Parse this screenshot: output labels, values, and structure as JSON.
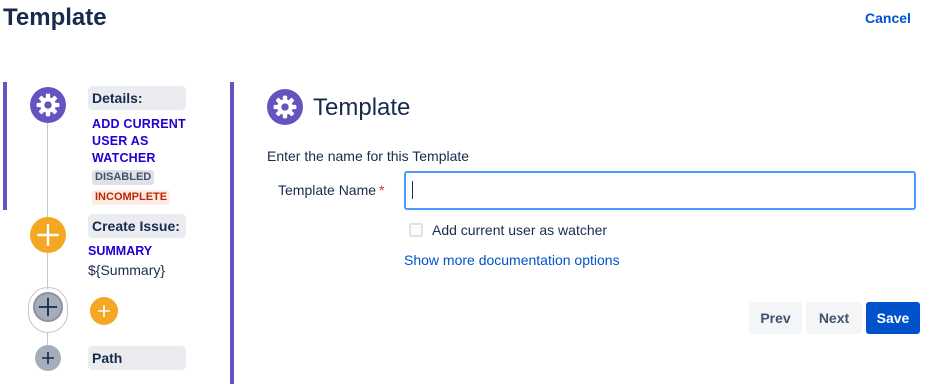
{
  "header": {
    "title": "Template",
    "cancel_label": "Cancel"
  },
  "steps": {
    "details": {
      "label": "Details:",
      "action": "ADD CURRENT USER AS WATCHER",
      "badges": [
        "DISABLED",
        "INCOMPLETE"
      ]
    },
    "create_issue": {
      "label": "Create Issue:",
      "field_key": "SUMMARY",
      "field_value": "${Summary}"
    },
    "path": {
      "label": "Path"
    }
  },
  "form": {
    "title": "Template",
    "instructions": "Enter the name for this Template",
    "name_label": "Template Name",
    "required_marker": "*",
    "name_value": "",
    "watcher_label": "Add current user as watcher",
    "watcher_checked": false,
    "doc_link": "Show more documentation options"
  },
  "buttons": {
    "prev": "Prev",
    "next": "Next",
    "save": "Save"
  },
  "icons": {
    "step_details": "gear-icon",
    "step_create": "plus-icon",
    "step_add": "plus-icon",
    "step_path": "plus-icon"
  },
  "colors": {
    "accent": "#6554c0",
    "add": "#f5a623",
    "primary": "#0052cc",
    "link_bold": "#1e00d4",
    "text": "#172b4d"
  }
}
